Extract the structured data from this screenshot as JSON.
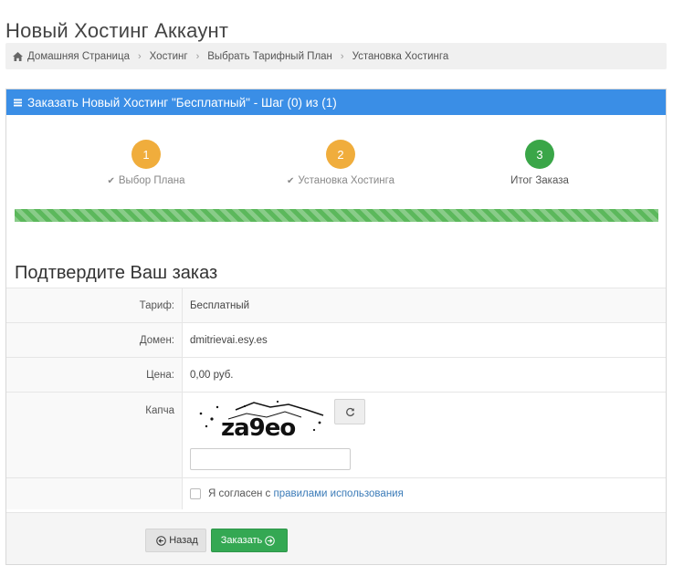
{
  "page": {
    "title": "Новый Хостинг Аккаунт"
  },
  "breadcrumb": [
    {
      "label": "Домашняя Страница"
    },
    {
      "label": "Хостинг"
    },
    {
      "label": "Выбрать Тарифный План"
    },
    {
      "label": "Установка Хостинга"
    }
  ],
  "panel": {
    "title": "Заказать Новый Хостинг \"Бесплатный\" - Шаг (0) из (1)"
  },
  "steps": [
    {
      "number": "1",
      "label": "Выбор Плана",
      "done": true,
      "color": "#f0ad3c"
    },
    {
      "number": "2",
      "label": "Установка Хостинга",
      "done": true,
      "color": "#f0ad3c"
    },
    {
      "number": "3",
      "label": "Итог Заказа",
      "done": false,
      "color": "#3aa648"
    }
  ],
  "progress": {
    "percent": 100,
    "color": "#5cb85c"
  },
  "section": {
    "title": "Подтвердите Ваш заказ"
  },
  "summary": {
    "tariff_label": "Тариф:",
    "tariff_value": "Бесплатный",
    "domain_label": "Домен:",
    "domain_value": "dmitrievai.esy.es",
    "price_label": "Цена:",
    "price_value": "0,00 руб."
  },
  "captcha": {
    "label": "Капча",
    "image_text": "za9eo",
    "input_value": ""
  },
  "agreement": {
    "prefix": "Я согласен с",
    "link": "правилами использования",
    "checked": false
  },
  "buttons": {
    "back": "Назад",
    "order": "Заказать"
  },
  "colors": {
    "header": "#3a8ee6",
    "order_button": "#34a853",
    "link": "#3b7bb8"
  }
}
